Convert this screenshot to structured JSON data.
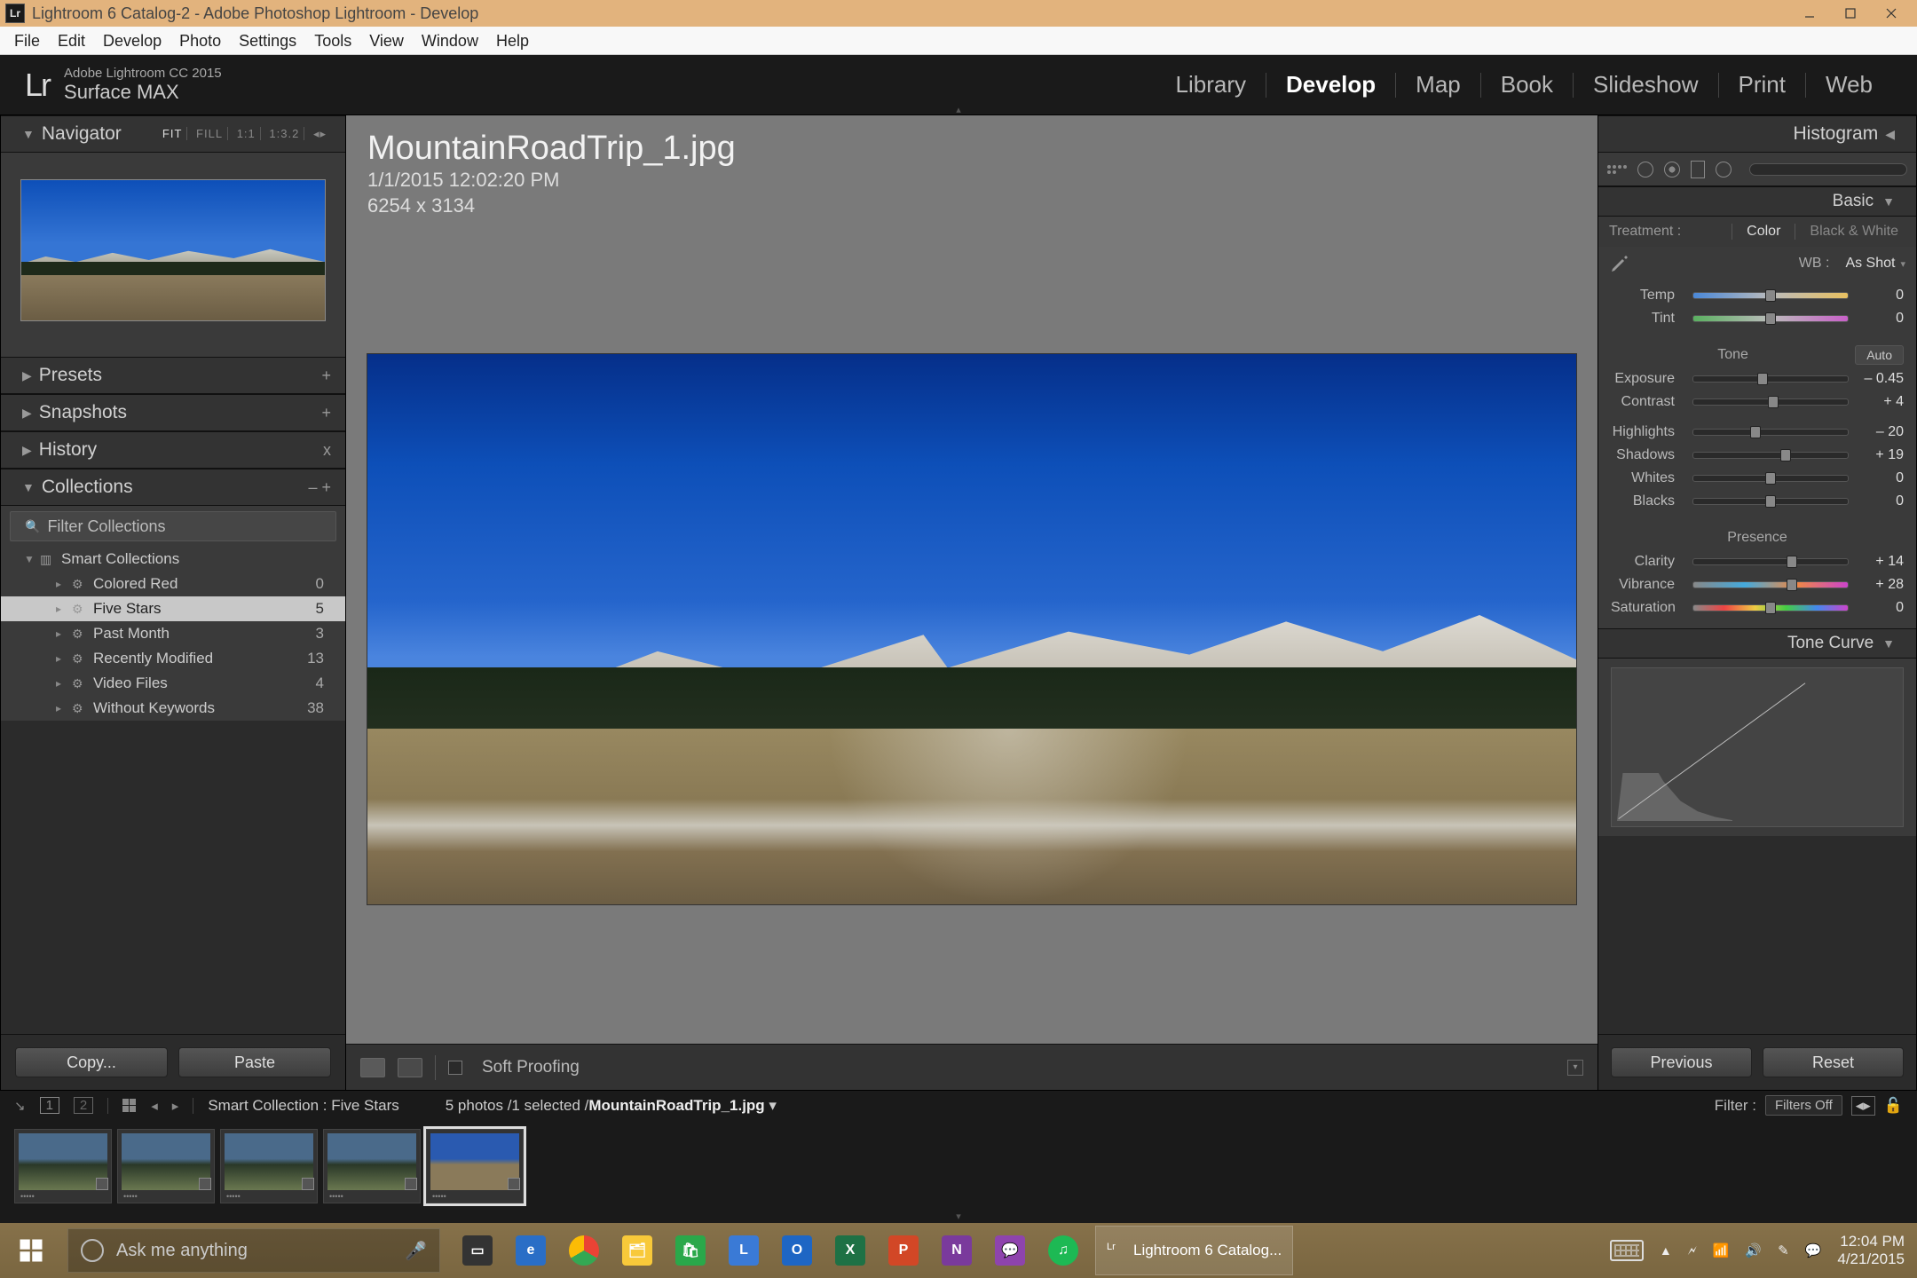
{
  "window": {
    "title": "Lightroom 6 Catalog-2 - Adobe Photoshop Lightroom - Develop",
    "badge": "Lr"
  },
  "menu": [
    "File",
    "Edit",
    "Develop",
    "Photo",
    "Settings",
    "Tools",
    "View",
    "Window",
    "Help"
  ],
  "identity": {
    "logo": "Lr",
    "line1": "Adobe Lightroom CC 2015",
    "line2": "Surface MAX"
  },
  "modules": [
    "Library",
    "Develop",
    "Map",
    "Book",
    "Slideshow",
    "Print",
    "Web"
  ],
  "active_module": "Develop",
  "left": {
    "navigator": {
      "title": "Navigator",
      "zoom_opts": [
        "FIT",
        "FILL",
        "1:1",
        "1:3.2"
      ],
      "zoom_selected": "FIT"
    },
    "sections": [
      {
        "title": "Presets",
        "action": "+"
      },
      {
        "title": "Snapshots",
        "action": "+"
      },
      {
        "title": "History",
        "action": "x"
      }
    ],
    "collections": {
      "title": "Collections",
      "filter_placeholder": "Filter Collections",
      "group": "Smart Collections",
      "items": [
        {
          "label": "Colored Red",
          "count": 0
        },
        {
          "label": "Five Stars",
          "count": 5,
          "selected": true
        },
        {
          "label": "Past Month",
          "count": 3
        },
        {
          "label": "Recently Modified",
          "count": 13
        },
        {
          "label": "Video Files",
          "count": 4
        },
        {
          "label": "Without Keywords",
          "count": 38
        }
      ]
    },
    "buttons": {
      "copy": "Copy...",
      "paste": "Paste"
    }
  },
  "center": {
    "filename": "MountainRoadTrip_1.jpg",
    "datetime": "1/1/2015 12:02:20 PM",
    "dimensions": "6254 x 3134",
    "soft_proof_label": "Soft Proofing"
  },
  "right": {
    "histogram_title": "Histogram",
    "basic": {
      "title": "Basic",
      "treatment_label": "Treatment :",
      "treatment_opts": [
        "Color",
        "Black & White"
      ],
      "treatment_selected": "Color",
      "wb_label": "WB :",
      "wb_value": "As Shot",
      "tone_title": "Tone",
      "auto_label": "Auto",
      "presence_title": "Presence",
      "sliders_wb": [
        {
          "label": "Temp",
          "value": "0",
          "pos": 50,
          "cls": "temp"
        },
        {
          "label": "Tint",
          "value": "0",
          "pos": 50,
          "cls": "tint"
        }
      ],
      "sliders_tone": [
        {
          "label": "Exposure",
          "value": "– 0.45",
          "pos": 45
        },
        {
          "label": "Contrast",
          "value": "+ 4",
          "pos": 52
        }
      ],
      "sliders_tone2": [
        {
          "label": "Highlights",
          "value": "– 20",
          "pos": 40
        },
        {
          "label": "Shadows",
          "value": "+ 19",
          "pos": 60
        },
        {
          "label": "Whites",
          "value": "0",
          "pos": 50
        },
        {
          "label": "Blacks",
          "value": "0",
          "pos": 50
        }
      ],
      "sliders_presence": [
        {
          "label": "Clarity",
          "value": "+ 14",
          "pos": 64
        },
        {
          "label": "Vibrance",
          "value": "+ 28",
          "pos": 64,
          "cls": "vib"
        },
        {
          "label": "Saturation",
          "value": "0",
          "pos": 50,
          "cls": "sat"
        }
      ]
    },
    "tone_curve_title": "Tone Curve",
    "buttons": {
      "prev": "Previous",
      "reset": "Reset"
    }
  },
  "infobar": {
    "collection": "Smart Collection : Five Stars",
    "count": "5 photos ",
    "selected": "/1 selected /",
    "current": "MountainRoadTrip_1.jpg",
    "filter_label": "Filter :",
    "filter_value": "Filters Off"
  },
  "taskbar": {
    "search_placeholder": "Ask me anything",
    "app_label": "Lightroom 6 Catalog...",
    "time": "12:04 PM",
    "date": "4/21/2015"
  }
}
